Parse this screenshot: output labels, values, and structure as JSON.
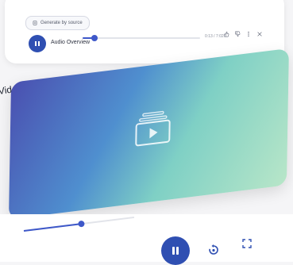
{
  "audio": {
    "source_chip_label": "Generate by source",
    "title": "Audio Overview",
    "time": "0:13 / 7:02",
    "progress": 0.1,
    "icons": [
      "thumbs-up-icon",
      "thumbs-down-icon",
      "more-icon",
      "close-icon"
    ]
  },
  "video": {
    "title": "Video Overview",
    "progress": 0.52
  },
  "colors": {
    "accent": "#2f4fb2",
    "gradient_start": "#4a4fb0",
    "gradient_mid": "#7fd0c5",
    "gradient_end": "#b8e6c8"
  }
}
